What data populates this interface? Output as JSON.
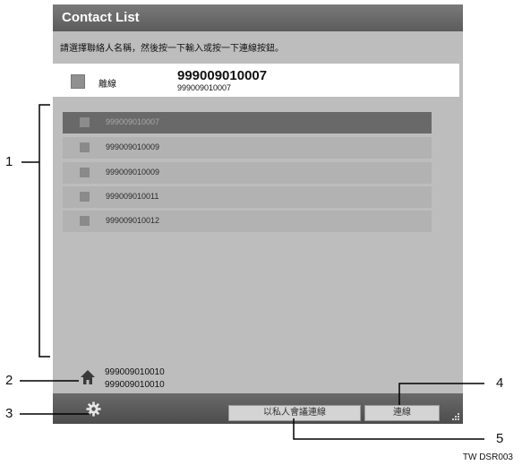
{
  "screen": {
    "title": "Contact List",
    "instruction": "請選擇聯絡人名稱，然後按一下輸入或按一下連線按鈕。",
    "status": {
      "label": "離線",
      "current_number": "999009010007",
      "current_number_sub": "999009010007"
    },
    "contacts": [
      {
        "number": "999009010007",
        "selected": true
      },
      {
        "number": "999009010009",
        "selected": false
      },
      {
        "number": "999009010009",
        "selected": false
      },
      {
        "number": "999009010011",
        "selected": false
      },
      {
        "number": "999009010012",
        "selected": false
      }
    ],
    "home": {
      "line1": "999009010010",
      "line2": "999009010010"
    },
    "buttons": {
      "private_connect": "以私人會議連線",
      "connect": "連線"
    }
  },
  "callouts": {
    "c1": "1",
    "c2": "2",
    "c3": "3",
    "c4": "4",
    "c5": "5"
  },
  "footer_code": "TW DSR003",
  "colors": {
    "titlebar": "#5c5c5c",
    "panel_bg": "#bdbdbd",
    "selected_row": "#696969",
    "row": "#b2b2b2"
  }
}
